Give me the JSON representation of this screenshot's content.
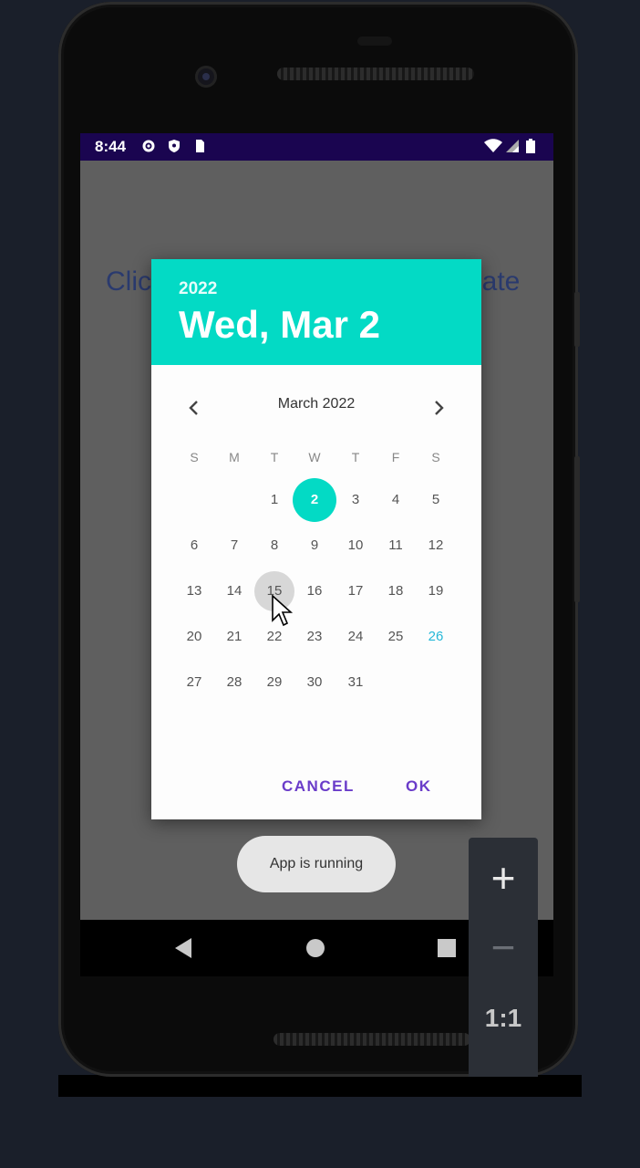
{
  "status_bar": {
    "time": "8:44"
  },
  "background_text": {
    "left": "Clic",
    "right": "late"
  },
  "dialog": {
    "year": "2022",
    "selected_date": "Wed, Mar 2",
    "month_label": "March 2022",
    "weekdays": [
      "S",
      "M",
      "T",
      "W",
      "T",
      "F",
      "S"
    ],
    "days": [
      "1",
      "2",
      "3",
      "4",
      "5",
      "6",
      "7",
      "8",
      "9",
      "10",
      "11",
      "12",
      "13",
      "14",
      "15",
      "16",
      "17",
      "18",
      "19",
      "20",
      "21",
      "22",
      "23",
      "24",
      "25",
      "26",
      "27",
      "28",
      "29",
      "30",
      "31"
    ],
    "selected_day": "2",
    "hovered_day": "15",
    "highlighted_day": "26",
    "cancel_label": "CANCEL",
    "ok_label": "OK",
    "accent_color": "#03dac5",
    "button_color": "#6a3cc9"
  },
  "toast": {
    "text": "App is running"
  },
  "zoom_panel": {
    "zoom_in": "+",
    "zoom_out": "−",
    "actual_size": "1:1"
  }
}
